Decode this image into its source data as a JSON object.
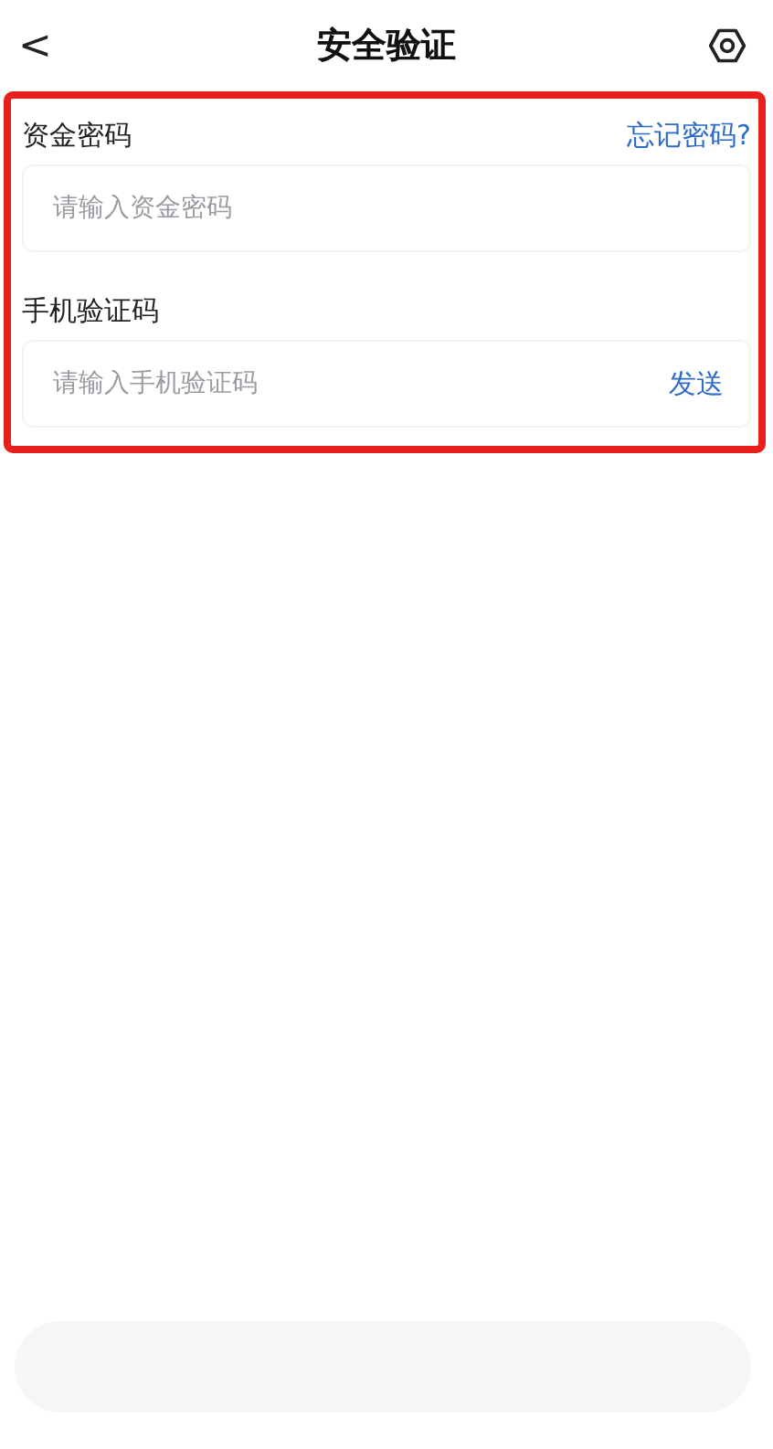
{
  "header": {
    "back": "<",
    "title": "安全验证"
  },
  "sections": [
    {
      "label": "资金密码",
      "link": "忘记密码?",
      "placeholder": "请输入资金密码"
    },
    {
      "label": "手机验证码",
      "placeholder": "请输入手机验证码",
      "action": "发送"
    }
  ]
}
